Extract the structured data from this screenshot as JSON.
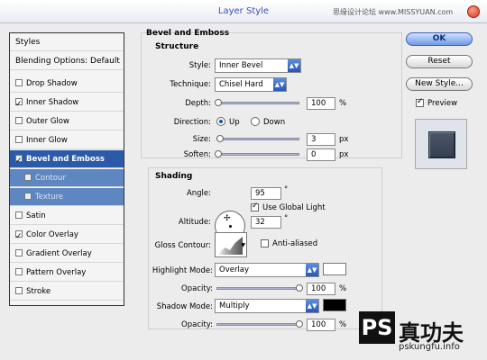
{
  "window": {
    "title": "Layer Style",
    "watermark": "思缘设计论坛 www.MISSYUAN.com"
  },
  "sidebar": {
    "items": [
      {
        "label": "Styles",
        "checked": null,
        "state": "header"
      },
      {
        "label": "Blending Options: Default",
        "checked": null,
        "state": "header"
      },
      {
        "label": "Drop Shadow",
        "checked": false,
        "state": ""
      },
      {
        "label": "Inner Shadow",
        "checked": true,
        "state": ""
      },
      {
        "label": "Outer Glow",
        "checked": false,
        "state": ""
      },
      {
        "label": "Inner Glow",
        "checked": false,
        "state": ""
      },
      {
        "label": "Bevel and Emboss",
        "checked": true,
        "state": "active"
      },
      {
        "label": "Contour",
        "checked": false,
        "state": "sub"
      },
      {
        "label": "Texture",
        "checked": false,
        "state": "sub"
      },
      {
        "label": "Satin",
        "checked": false,
        "state": ""
      },
      {
        "label": "Color Overlay",
        "checked": true,
        "state": ""
      },
      {
        "label": "Gradient Overlay",
        "checked": false,
        "state": ""
      },
      {
        "label": "Pattern Overlay",
        "checked": false,
        "state": ""
      },
      {
        "label": "Stroke",
        "checked": false,
        "state": ""
      }
    ]
  },
  "bevel": {
    "section_title": "Bevel and Emboss",
    "structure_title": "Structure",
    "style_label": "Style:",
    "style_value": "Inner Bevel",
    "technique_label": "Technique:",
    "technique_value": "Chisel Hard",
    "depth_label": "Depth:",
    "depth_value": "100",
    "depth_unit": "%",
    "direction_label": "Direction:",
    "direction_up": "Up",
    "direction_down": "Down",
    "size_label": "Size:",
    "size_value": "3",
    "size_unit": "px",
    "soften_label": "Soften:",
    "soften_value": "0",
    "soften_unit": "px"
  },
  "shading": {
    "title": "Shading",
    "angle_label": "Angle:",
    "angle_value": "95",
    "angle_unit": "°",
    "global_light_label": "Use Global Light",
    "altitude_label": "Altitude:",
    "altitude_value": "32",
    "altitude_unit": "°",
    "gloss_contour_label": "Gloss Contour:",
    "anti_aliased_label": "Anti-aliased",
    "highlight_mode_label": "Highlight Mode:",
    "highlight_mode_value": "Overlay",
    "highlight_color": "#ffffff",
    "opacity_label": "Opacity:",
    "highlight_opacity": "100",
    "opacity_unit": "%",
    "shadow_mode_label": "Shadow Mode:",
    "shadow_mode_value": "Multiply",
    "shadow_color": "#000000",
    "shadow_opacity": "100"
  },
  "buttons": {
    "ok": "OK",
    "reset": "Reset",
    "new_style": "New Style...",
    "preview_label": "Preview"
  },
  "brand": {
    "logo_text": "PS",
    "cn_text": "真功夫",
    "url": "pskungfu.info"
  }
}
